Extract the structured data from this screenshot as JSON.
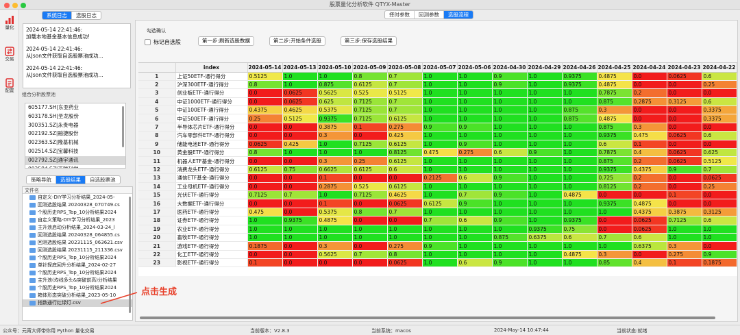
{
  "window": {
    "title": "股票量化分析软件 QTYX-Master"
  },
  "nav": [
    {
      "label": "量化",
      "icon": "bar-chart-icon"
    },
    {
      "label": "交易",
      "icon": "trade-icon"
    },
    {
      "label": "配置",
      "icon": "config-icon"
    }
  ],
  "log_tabs": [
    "系统日志",
    "选股日志"
  ],
  "logs": [
    {
      "time": "2024-05-14 22:41:46:",
      "msg": "加载本地基金基本信息成功!"
    },
    {
      "time": "2024-05-14 22:41:46:",
      "msg": "从Json文件获取自选股票池成功..."
    },
    {
      "time": "2024-05-14 22:41:46:",
      "msg": "从Json文件获取自选股票池成功..."
    }
  ],
  "pool": {
    "label": "组合分析股票池",
    "items": [
      "605177.SH|东亚药业",
      "603178.SH|圣龙股份",
      "300351.SZ|永贵电器",
      "002192.SZ|融捷股份",
      "002363.SZ|隆基机械",
      "002514.SZ|宝馨科技",
      "002792.SZ|通宇通讯",
      "002584.SZ|西陇科学"
    ],
    "selected_index": 6
  },
  "bottom_tabs": [
    "策略导航",
    "选股结果",
    "自选股票池"
  ],
  "files": {
    "header": "文件名",
    "items": [
      "自定义-DIY学习分析结果_2024-05-",
      "回测选股结果 20240328_070749.cs",
      "个股历史RPS_Top_10分析结果2024",
      "自定义策略-DIY学习分析结果_2023",
      "主升浪启动分析结果_2024-03-24_l",
      "回测选股结果 20240328_064855.cs",
      "回测选股结果 20231115_063621.csv",
      "回测选股结果 20231115_211336.csv",
      "个股历史RPS_Top_10分析结果2024",
      "单针探底回升分析结果_2024-02-27",
      "个股历史RPS_Top_10分析结果2024",
      "主升浪(均线多头&突破前高)分析结果",
      "个股历史RPS_Top_10分析结果2024",
      "箱体形态突破分析结果_2023-05-10",
      "指数通行红绿灯.csv"
    ],
    "selected_index": 14
  },
  "main_tabs": [
    "择时参数",
    "回测参数",
    "选股流程"
  ],
  "active_main_tab": 2,
  "panel": {
    "confirm_label": "勾选确认",
    "checkbox_label": "标记自选股",
    "steps": [
      "第一步:刷新选股数据",
      "第二步:开始条件选股",
      "第三步:保存选股结果"
    ]
  },
  "table": {
    "index_header": "index",
    "dates": [
      "2024-05-14",
      "2024-05-13",
      "2024-05-10",
      "2024-05-09",
      "2024-05-08",
      "2024-05-07",
      "2024-05-06",
      "2024-04-30",
      "2024-04-29",
      "2024-04-26",
      "2024-04-25",
      "2024-04-24",
      "2024-04-23",
      "2024-04-22"
    ],
    "rows": [
      {
        "name": "上证50ETF-通行得分",
        "values": [
          "0.5125",
          "1.0",
          "1.0",
          "0.8",
          "0.7",
          "1.0",
          "1.0",
          "0.9",
          "1.0",
          "0.9375",
          "0.4875",
          "0.0",
          "0.0625",
          "0.6"
        ]
      },
      {
        "name": "沪深300ETF-通行得分",
        "values": [
          "0.8",
          "1.0",
          "0.875",
          "0.6125",
          "0.7",
          "1.0",
          "1.0",
          "0.9",
          "1.0",
          "0.9375",
          "0.4875",
          "0.0",
          "0.0",
          "0.25"
        ]
      },
      {
        "name": "创业板ETF-通行得分",
        "values": [
          "0.0",
          "0.0625",
          "0.5625",
          "0.525",
          "0.5125",
          "1.0",
          "1.0",
          "1.0",
          "1.0",
          "1.0",
          "0.7875",
          "0.2",
          "0.0",
          "0.0"
        ]
      },
      {
        "name": "中证1000ETF-通行得分",
        "values": [
          "0.0",
          "0.0625",
          "0.625",
          "0.7125",
          "0.7",
          "1.0",
          "1.0",
          "1.0",
          "1.0",
          "1.0",
          "0.875",
          "0.2875",
          "0.3125",
          "0.6"
        ]
      },
      {
        "name": "中证100ETF-通行得分",
        "values": [
          "0.4375",
          "0.4625",
          "0.5375",
          "0.7125",
          "0.7",
          "1.0",
          "1.0",
          "1.0",
          "1.0",
          "0.875",
          "0.3",
          "0.0",
          "0.0",
          "0.3375"
        ]
      },
      {
        "name": "中证500ETF-通行得分",
        "values": [
          "0.25",
          "0.5125",
          "0.9375",
          "0.7125",
          "0.6125",
          "1.0",
          "1.0",
          "1.0",
          "1.0",
          "0.875",
          "0.4875",
          "0.0",
          "0.0",
          "0.3375"
        ]
      },
      {
        "name": "半导体芯片ETF-通行得分",
        "values": [
          "0.0",
          "0.0",
          "0.3875",
          "0.1",
          "0.275",
          "0.9",
          "0.9",
          "1.0",
          "1.0",
          "1.0",
          "0.875",
          "0.3",
          "0.0",
          "0.0"
        ]
      },
      {
        "name": "汽车零部件ETF-通行得分",
        "values": [
          "0.0",
          "0.0",
          "0.3",
          "0.0",
          "0.425",
          "1.0",
          "1.0",
          "1.0",
          "1.0",
          "1.0",
          "0.9375",
          "0.475",
          "0.0625",
          "0.6"
        ]
      },
      {
        "name": "储能电池ETF-通行得分",
        "values": [
          "0.0625",
          "0.425",
          "1.0",
          "0.7125",
          "0.6125",
          "1.0",
          "0.9",
          "1.0",
          "1.0",
          "1.0",
          "0.6",
          "0.1",
          "0.0",
          "0.0"
        ]
      },
      {
        "name": "黄金股ETF-通行得分",
        "values": [
          "0.8",
          "1.0",
          "1.0",
          "1.0",
          "0.8125",
          "0.475",
          "0.275",
          "0.6",
          "0.9",
          "1.0",
          "0.7875",
          "0.4",
          "0.0625",
          "0.625"
        ]
      },
      {
        "name": "机器人ETF基金-通行得分",
        "values": [
          "0.0",
          "0.0",
          "0.3",
          "0.25",
          "0.6125",
          "1.0",
          "1.0",
          "1.0",
          "1.0",
          "1.0",
          "0.875",
          "0.2",
          "0.0625",
          "0.5125"
        ]
      },
      {
        "name": "消费龙头ETF-通行得分",
        "values": [
          "0.6125",
          "0.75",
          "0.6625",
          "0.6125",
          "0.6",
          "1.0",
          "1.0",
          "1.0",
          "1.0",
          "1.0",
          "0.9375",
          "0.4375",
          "0.9",
          "0.7"
        ]
      },
      {
        "name": "通信ETF基金-通行得分",
        "values": [
          "0.0",
          "0.0",
          "0.1",
          "0.0",
          "0.0",
          "0.2125",
          "0.6",
          "0.9",
          "1.0",
          "1.0",
          "0.725",
          "0.2",
          "0.0",
          "0.0625"
        ]
      },
      {
        "name": "工业母机ETF-通行得分",
        "values": [
          "0.0",
          "0.0",
          "0.2875",
          "0.525",
          "0.6125",
          "1.0",
          "1.0",
          "1.0",
          "1.0",
          "1.0",
          "0.8125",
          "0.2",
          "0.0",
          "0.25"
        ]
      },
      {
        "name": "光伏ETF-通行得分",
        "values": [
          "0.7125",
          "0.7",
          "1.0",
          "0.7125",
          "0.4625",
          "1.0",
          "0.7",
          "0.9",
          "1.0",
          "0.4875",
          "0.0",
          "0.0",
          "0.1",
          "0.0"
        ]
      },
      {
        "name": "大数据ETF-通行得分",
        "values": [
          "0.0",
          "0.0",
          "0.1",
          "0.0",
          "0.0625",
          "0.6125",
          "0.9",
          "1.0",
          "1.0",
          "1.0",
          "0.9375",
          "0.4875",
          "0.0",
          "0.0"
        ]
      },
      {
        "name": "医药ETF-通行得分",
        "values": [
          "0.475",
          "0.0",
          "0.5375",
          "0.8",
          "0.7",
          "1.0",
          "1.0",
          "1.0",
          "1.0",
          "1.0",
          "1.0",
          "0.4375",
          "0.3875",
          "0.3125"
        ]
      },
      {
        "name": "证券ETF-通行得分",
        "values": [
          "1.0",
          "0.9375",
          "0.4875",
          "0.0",
          "0.0",
          "0.7",
          "0.6",
          "0.9",
          "1.0",
          "0.9375",
          "0.0",
          "0.0625",
          "0.7125",
          "0.6"
        ]
      },
      {
        "name": "农业ETF-通行得分",
        "values": [
          "1.0",
          "1.0",
          "1.0",
          "1.0",
          "1.0",
          "1.0",
          "1.0",
          "1.0",
          "0.9375",
          "0.75",
          "0.0",
          "0.0625",
          "1.0",
          "1.0"
        ]
      },
      {
        "name": "畜牧ETF-通行得分",
        "values": [
          "1.0",
          "1.0",
          "1.0",
          "1.0",
          "1.0",
          "1.0",
          "1.0",
          "0.875",
          "0.6375",
          "0.6",
          "0.7",
          "0.6",
          "1.0",
          "1.0"
        ]
      },
      {
        "name": "游戏ETF-通行得分",
        "values": [
          "0.1875",
          "0.0",
          "0.3",
          "0.0",
          "0.275",
          "0.9",
          "1.0",
          "1.0",
          "1.0",
          "1.0",
          "1.0",
          "0.6375",
          "0.3",
          "0.0"
        ]
      },
      {
        "name": "化工ETF-通行得分",
        "values": [
          "0.0",
          "0.0",
          "0.5625",
          "0.7",
          "0.8",
          "1.0",
          "1.0",
          "1.0",
          "1.0",
          "0.4875",
          "0.3",
          "0.0",
          "0.275",
          "0.9"
        ]
      },
      {
        "name": "影视ETF-通行得分",
        "values": [
          "0.1",
          "0.0",
          "0.0",
          "0.0",
          "0.0625",
          "1.0",
          "0.6",
          "0.9",
          "1.0",
          "1.0",
          "0.85",
          "0.4",
          "0.1",
          "0.1875"
        ]
      }
    ]
  },
  "annotation": "点击生成",
  "colors": {
    "accent": "#1a7bf5",
    "annotation": "#e8402a",
    "high": "#20e020",
    "low": "#f21c1c",
    "mid": "#f5e84a"
  },
  "status": {
    "wechat": "公众号：元宵大师带你用 Python 量化交易",
    "version": "当前版本：V2.8.3",
    "system": "当前系统：macos",
    "time": "2024-May-14 10:47:44",
    "state": "当前状态:就绪"
  }
}
